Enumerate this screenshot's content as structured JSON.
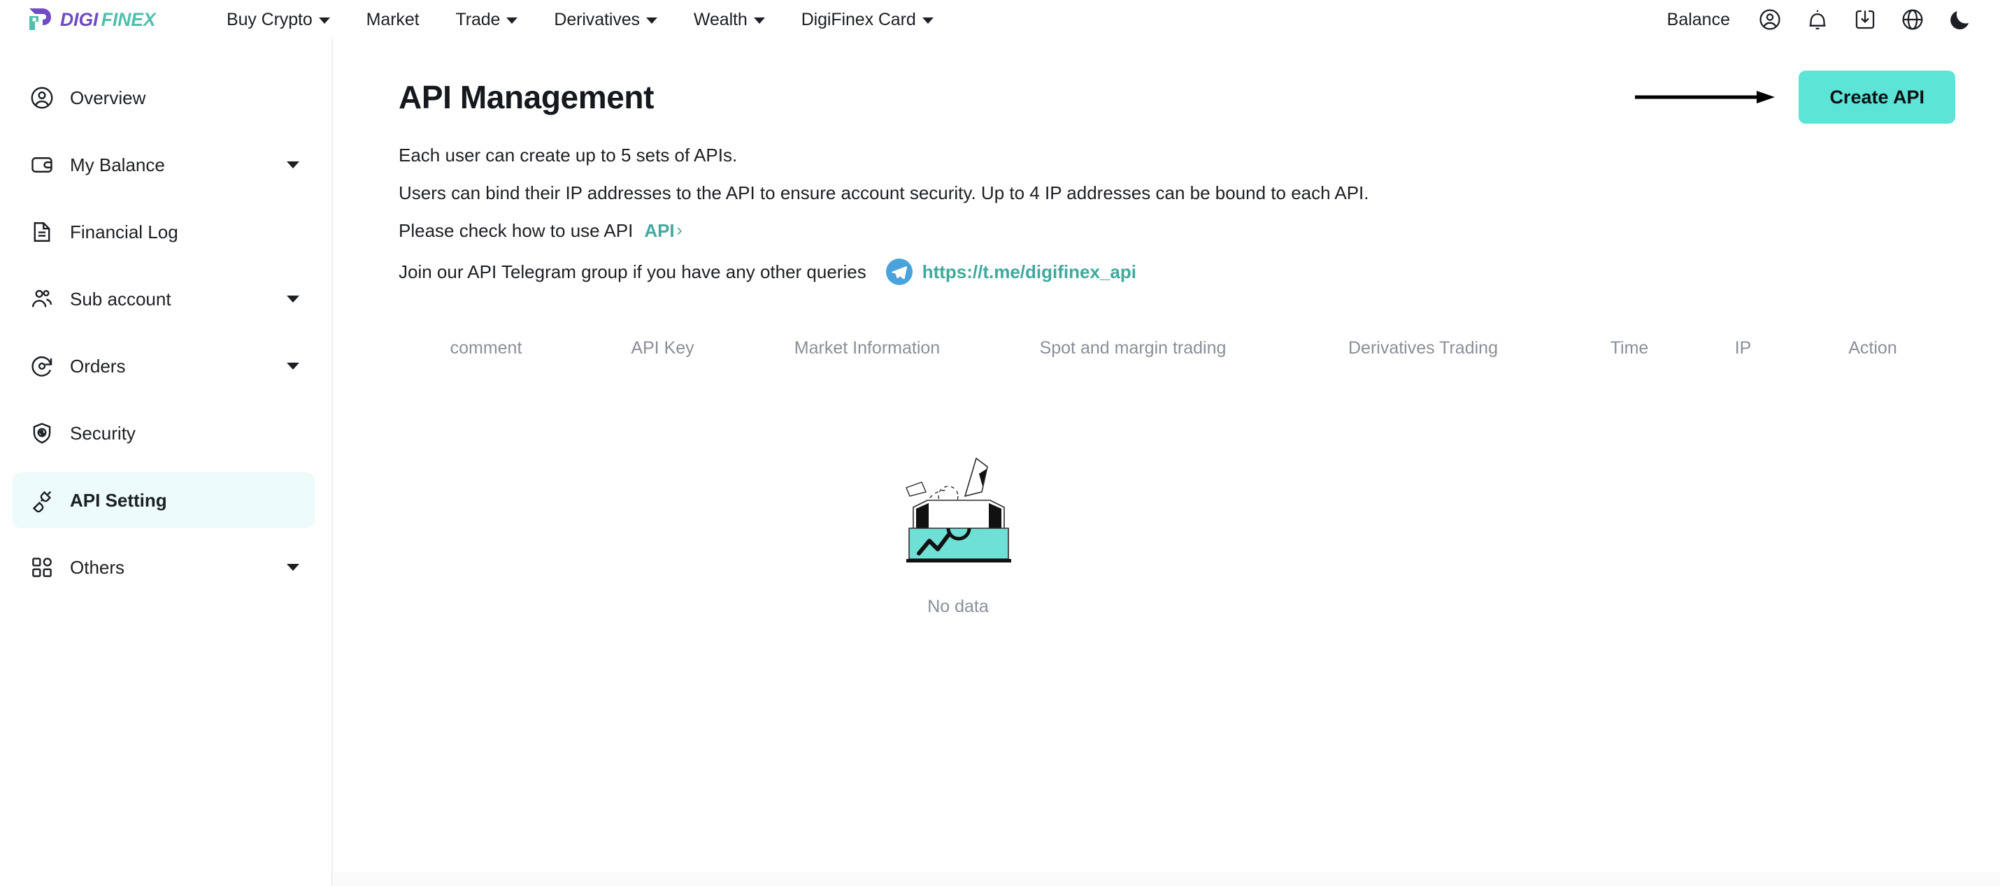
{
  "brand": {
    "name": "DIGIFINEX",
    "logo_purple": "#6F4BC4",
    "logo_teal": "#4FBFAE"
  },
  "topnav": {
    "items": [
      {
        "label": "Buy Crypto",
        "has_caret": true
      },
      {
        "label": "Market",
        "has_caret": false
      },
      {
        "label": "Trade",
        "has_caret": true
      },
      {
        "label": "Derivatives",
        "has_caret": true
      },
      {
        "label": "Wealth",
        "has_caret": true
      },
      {
        "label": "DigiFinex Card",
        "has_caret": true
      }
    ],
    "balance_label": "Balance",
    "icons": [
      "user-circle-icon",
      "bell-icon",
      "download-icon",
      "globe-icon",
      "moon-icon"
    ]
  },
  "sidebar": {
    "items": [
      {
        "label": "Overview",
        "icon": "user-circle-icon",
        "caret": false,
        "active": false
      },
      {
        "label": "My Balance",
        "icon": "wallet-icon",
        "caret": true,
        "active": false
      },
      {
        "label": "Financial Log",
        "icon": "document-icon",
        "caret": false,
        "active": false
      },
      {
        "label": "Sub account",
        "icon": "users-icon",
        "caret": true,
        "active": false
      },
      {
        "label": "Orders",
        "icon": "orders-icon",
        "caret": true,
        "active": false
      },
      {
        "label": "Security",
        "icon": "shield-dollar-icon",
        "caret": false,
        "active": false
      },
      {
        "label": "API Setting",
        "icon": "plug-icon",
        "caret": false,
        "active": true
      },
      {
        "label": "Others",
        "icon": "grid-icon",
        "caret": true,
        "active": false
      }
    ],
    "active_bg": "#EDFBFA"
  },
  "page": {
    "title": "API Management",
    "create_button": "Create API",
    "create_button_color": "#5CE4D7",
    "descriptions": {
      "line1": "Each user can create up to 5 sets of APIs.",
      "line2": "Users can bind their IP addresses to the API to ensure account security. Up to 4 IP addresses can be bound to each API.",
      "line3_prefix": "Please check how to use API",
      "line3_link": "API",
      "line3_chevron": "›",
      "line4_prefix": "Join our API Telegram group if you have any other queries",
      "line4_link": "https://t.me/digifinex_api",
      "telegram_icon_color": "#4BA3DC",
      "link_color": "#45A99C"
    }
  },
  "table": {
    "columns": [
      "comment",
      "API Key",
      "Market Information",
      "Spot and margin trading",
      "Derivatives Trading",
      "Time",
      "IP",
      "Action"
    ],
    "rows": [],
    "empty_text": "No data",
    "empty_illustration": "empty-box-icon",
    "empty_box_color": "#6FE0D6"
  }
}
